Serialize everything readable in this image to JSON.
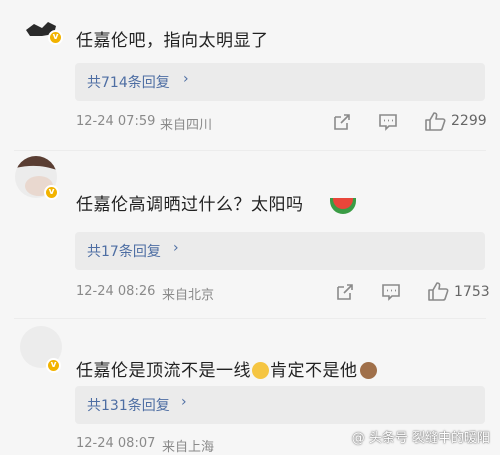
{
  "comments": [
    {
      "text": "任嘉伦吧，指向太明显了",
      "replies_label": "共714条回复",
      "time": "12-24 07:59",
      "location": "来自四川",
      "likes": "2299"
    },
    {
      "text": "任嘉伦高调晒过什么？太阳吗",
      "replies_label": "共17条回复",
      "time": "12-24 08:26",
      "location": "来自北京",
      "likes": "1753",
      "emoji": "watermelon-emoji"
    },
    {
      "text_a": "任嘉伦是顶流不是一线",
      "text_b": "肯定不是他",
      "replies_label": "共131条回复",
      "time": "12-24 08:07",
      "location": "来自上海",
      "emoji_a": "cat-face-emoji",
      "emoji_b": "see-no-evil-monkey-emoji"
    }
  ],
  "icons": {
    "share": "share-icon",
    "comment": "comment-icon",
    "like": "thumbs-up-icon",
    "chevron": "chevron-right-icon",
    "verified": "verified-badge-icon"
  },
  "chevron_glyph": "›",
  "verified_glyph": "v",
  "watermark": "@ 头条号 裂缝中的暖阳",
  "colors": {
    "link": "#4e6ea3",
    "text": "#222222",
    "meta": "#8a8a8a",
    "verified": "#f2b300",
    "reply_bg": "#ebebeb"
  }
}
